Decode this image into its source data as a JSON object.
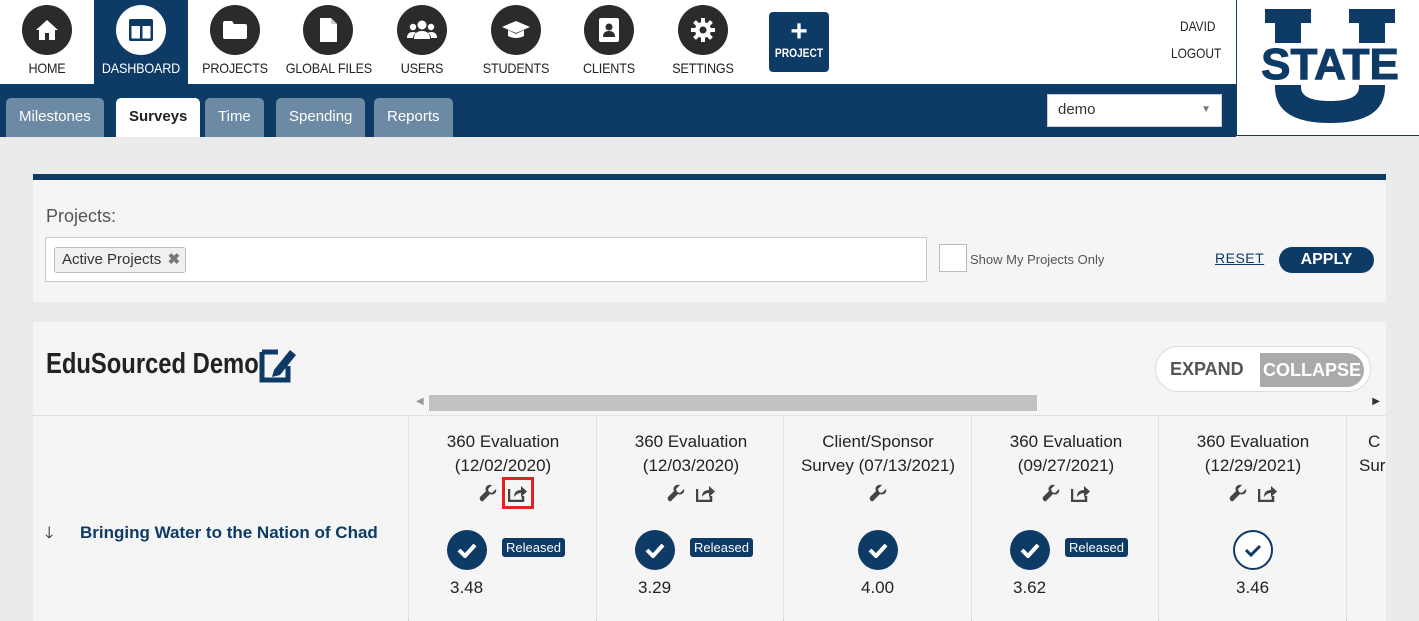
{
  "nav": {
    "items": [
      {
        "label": "HOME",
        "icon": "home-icon"
      },
      {
        "label": "DASHBOARD",
        "icon": "dashboard-icon",
        "active": true
      },
      {
        "label": "PROJECTS",
        "icon": "folder-icon"
      },
      {
        "label": "GLOBAL FILES",
        "icon": "file-icon"
      },
      {
        "label": "USERS",
        "icon": "users-icon"
      },
      {
        "label": "STUDENTS",
        "icon": "graduation-cap-icon"
      },
      {
        "label": "CLIENTS",
        "icon": "address-book-icon"
      },
      {
        "label": "SETTINGS",
        "icon": "gear-icon"
      }
    ],
    "new_project": {
      "plus": "+",
      "label": "PROJECT"
    },
    "user": "DAVID",
    "logout": "LOGOUT"
  },
  "logo": {
    "text": "STATE"
  },
  "subnav": {
    "tabs": [
      "Milestones",
      "Surveys",
      "Time",
      "Spending",
      "Reports"
    ],
    "active_tab": "Surveys",
    "select_value": "demo"
  },
  "filters": {
    "projects_label": "Projects:",
    "chip": "Active Projects",
    "chip_remove": "✖",
    "show_mine": "Show My Projects Only",
    "reset": "RESET",
    "apply": "APPLY"
  },
  "project": {
    "title": "EduSourced Demo",
    "expand": "EXPAND",
    "collapse": "COLLAPSE",
    "row": {
      "arrow": "🡓",
      "name": "Bringing Water to the Nation of Chad"
    },
    "surveys": [
      {
        "name1": "360 Evaluation",
        "name2": "(12/02/2020)",
        "share": true,
        "status": "Released",
        "score": "3.48",
        "check": "filled"
      },
      {
        "name1": "360 Evaluation",
        "name2": "(12/03/2020)",
        "share": true,
        "status": "Released",
        "score": "3.29",
        "check": "filled"
      },
      {
        "name1": "Client/Sponsor",
        "name2": "Survey (07/13/2021)",
        "share": false,
        "status": "",
        "score": "4.00",
        "check": "filled"
      },
      {
        "name1": "360 Evaluation",
        "name2": "(09/27/2021)",
        "share": true,
        "status": "Released",
        "score": "3.62",
        "check": "filled"
      },
      {
        "name1": "360 Evaluation",
        "name2": "(12/29/2021)",
        "share": true,
        "status": "",
        "score": "3.46",
        "check": "outline"
      },
      {
        "name1": "C",
        "name2": "Sur",
        "share": false,
        "status": "",
        "score": "",
        "check": "none"
      }
    ]
  },
  "colors": {
    "primary": "#0e3a66",
    "tab": "#6c8aa3",
    "highlight": "#e52020"
  }
}
